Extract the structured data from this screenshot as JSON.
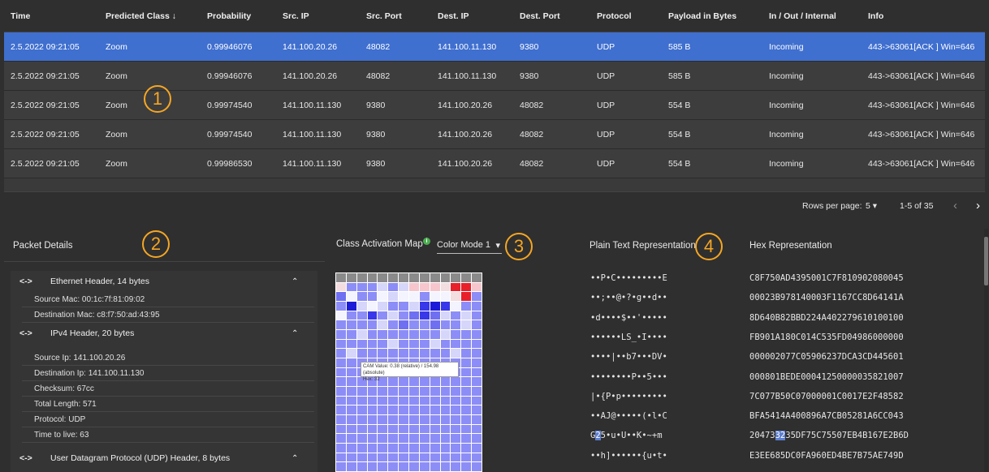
{
  "table": {
    "columns": [
      "Time",
      "Predicted Class ↓",
      "Probability",
      "Src. IP",
      "Src. Port",
      "Dest. IP",
      "Dest. Port",
      "Protocol",
      "Payload in Bytes",
      "In / Out / Internal",
      "Info"
    ],
    "rows": [
      [
        "2.5.2022 09:21:05",
        "Zoom",
        "0.99946076",
        "141.100.20.26",
        "48082",
        "141.100.11.130",
        "9380",
        "UDP",
        "585 B",
        "Incoming",
        "443->63061[ACK ] Win=646"
      ],
      [
        "2.5.2022 09:21:05",
        "Zoom",
        "0.99946076",
        "141.100.20.26",
        "48082",
        "141.100.11.130",
        "9380",
        "UDP",
        "585 B",
        "Incoming",
        "443->63061[ACK ] Win=646"
      ],
      [
        "2.5.2022 09:21:05",
        "Zoom",
        "0.99974540",
        "141.100.11.130",
        "9380",
        "141.100.20.26",
        "48082",
        "UDP",
        "554 B",
        "Incoming",
        "443->63061[ACK ] Win=646"
      ],
      [
        "2.5.2022 09:21:05",
        "Zoom",
        "0.99974540",
        "141.100.11.130",
        "9380",
        "141.100.20.26",
        "48082",
        "UDP",
        "554 B",
        "Incoming",
        "443->63061[ACK ] Win=646"
      ],
      [
        "2.5.2022 09:21:05",
        "Zoom",
        "0.99986530",
        "141.100.11.130",
        "9380",
        "141.100.20.26",
        "48082",
        "UDP",
        "554 B",
        "Incoming",
        "443->63061[ACK ] Win=646"
      ]
    ],
    "selected_row": 0
  },
  "pagination": {
    "rows_per_page_label": "Rows per page:",
    "rows_per_page_value": "5 ▾",
    "range": "1-5 of 35",
    "prev_icon": "‹",
    "next_icon": "›"
  },
  "panels": {
    "packet_details": "Packet Details",
    "cam": "Class Activation Map",
    "color_mode": "Color Mode 1",
    "color_mode_caret": "▾",
    "plain": "Plain Text Representation",
    "hex": "Hex Representation"
  },
  "annotations": [
    "1",
    "2",
    "3",
    "4"
  ],
  "info_dot": "i",
  "packet_details": {
    "ethernet": {
      "arrows": "<->",
      "label": "Ethernet Header, 14 bytes",
      "chevron": "⌃",
      "fields": [
        "Source Mac: 00:1c:7f:81:09:02",
        "Destination Mac: c8:f7:50:ad:43:95"
      ]
    },
    "ipv4": {
      "arrows": "<->",
      "label": "IPv4 Header, 20 bytes",
      "chevron": "⌃",
      "fields": [
        "Source Ip: 141.100.20.26",
        "Destination Ip: 141.100.11.130",
        "Checksum: 67cc",
        "Total Length: 571",
        "Protocol: UDP",
        "Time to live: 63"
      ]
    },
    "udp": {
      "arrows": "<->",
      "label": "User Datagram Protocol (UDP) Header, 8 bytes",
      "chevron": "⌃"
    }
  },
  "cam": {
    "tooltip_line1": "CAM Value: 0.38 (relative) / 154.98 (absolute)",
    "tooltip_line2": "Hex: 32",
    "colors": {
      "header": "#8a8a8a",
      "base": "#8d8df7",
      "light": "#d6d6fb",
      "white": "#f4f4ff",
      "medium": "#6f6ff2",
      "blue": "#3838ea",
      "darkblue": "#1c1cd8",
      "pink": "#f6c6cc",
      "lightpink": "#f3dde0",
      "red": "#e8202a"
    }
  },
  "plain_text": [
    "••P•C•••••••••E",
    "••;••@•?•g••d••",
    "•d••••$••'•••••",
    "••••••LS_•I••••",
    "••••|••b7•••DV•",
    "••••••••P••5•••",
    "|•{P•p•••••••••",
    "••AJ@•••••(•l•C",
    {
      "pre": "G",
      "hl": "2",
      "post": "5•u•U••K•~+m"
    },
    "••h]••••••{u•t•"
  ],
  "hex": [
    "C8F750AD4395001C7F810902080045",
    "00023B978140003F1167CC8D64141A",
    "8D640B82BBD224A402279610100100",
    "FB901A180C014C535FD04986000000",
    "000002077C05906237DCA3CD445601",
    "000801BEDE00041250000035821007",
    "7C077B50C07000001C0017E2F48582",
    "BFA5414A400896A7CB05281A6CC043",
    {
      "pre": "20473",
      "hl": "32",
      "post": "35DF75C75507EB4B167E2B6D"
    },
    "E3EE685DC0FA960ED4BE7B75AE749D"
  ]
}
